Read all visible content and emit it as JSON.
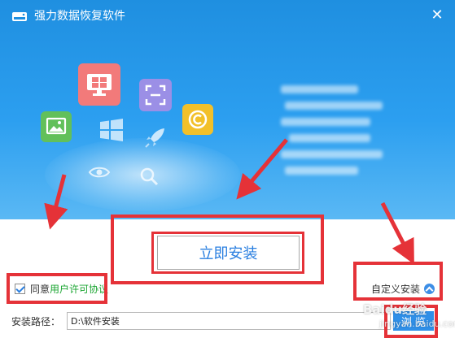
{
  "window": {
    "title": "强力数据恢复软件",
    "close_glyph": "✕"
  },
  "hero": {
    "icons": [
      "monitor-icon",
      "scan-icon",
      "copyright-icon",
      "image-icon",
      "windows-icon",
      "rocket-icon",
      "eye-icon",
      "search-icon"
    ]
  },
  "install": {
    "button_label": "立即安装"
  },
  "agreement": {
    "checked": true,
    "label": "同意",
    "link": "用户许可协议"
  },
  "custom_install": {
    "label": "自定义安装"
  },
  "path": {
    "label": "安装路径：",
    "value": "D:\\软件安装"
  },
  "browse": {
    "label": "浏 览"
  },
  "watermark": {
    "text": "Baidu经验",
    "sub": "jingyan.baidu.com"
  },
  "colors": {
    "accent": "#2f8fe8",
    "hero_top": "#1f8fe0",
    "annotation_red": "#e53238",
    "link_green": "#1aa530"
  }
}
